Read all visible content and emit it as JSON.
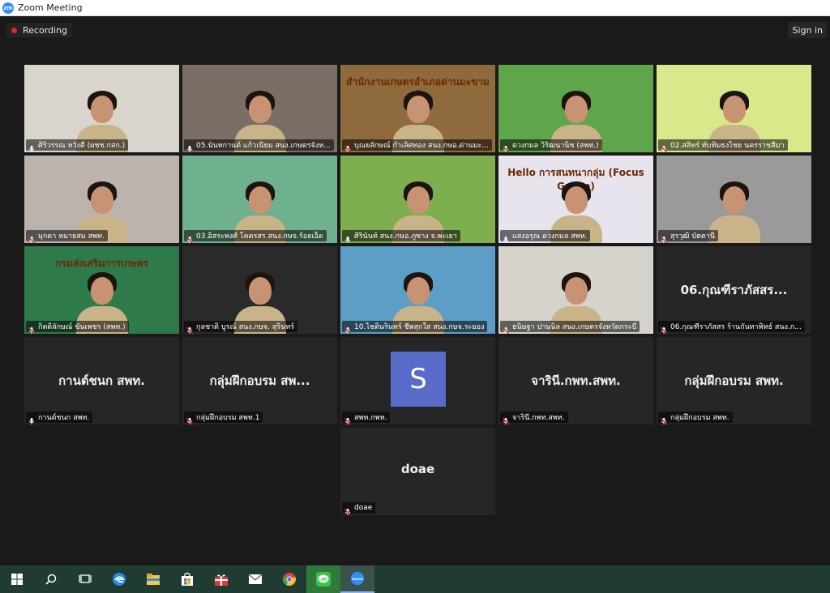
{
  "window": {
    "title": "Zoom Meeting"
  },
  "topbar": {
    "recording_label": "Recording",
    "signin_label": "Sign in"
  },
  "tiles": [
    {
      "name": "ศิริวรรณ หวังดี (ผชช.กสก.)",
      "type": "video",
      "muted": false,
      "active": false,
      "bg": "#d9d4cc"
    },
    {
      "name": "05.นันทกานต์ แก้วเนียม สนง.เกษตรจังห...",
      "type": "video",
      "muted": false,
      "active": true,
      "bg": "#7a6e66"
    },
    {
      "name": "บุณยลักษณ์ กำเลิศทอง สนง.กษอ.ด่านมะ...",
      "type": "video",
      "muted": true,
      "active": false,
      "bg": "#8f6a3c",
      "banner": "สำนักงานเกษตรอำเภอด่านมะขามเตี้ย"
    },
    {
      "name": "ดวงกมล วิริฒนานิช (สพท.)",
      "type": "video",
      "muted": true,
      "active": false,
      "bg": "#5fa64a"
    },
    {
      "name": "02.สสิทร์ ทับทิมธงไชย นครราชสีมา",
      "type": "video",
      "muted": true,
      "active": false,
      "bg": "#d8e88a"
    },
    {
      "name": "มุกดา หมายสม สพท.",
      "type": "video",
      "muted": true,
      "active": false,
      "bg": "#bdb3ae"
    },
    {
      "name": "03.อิสระพงศ์ โคตรสร สนง.กษจ.ร้อยเอ็ด",
      "type": "video",
      "muted": true,
      "active": false,
      "bg": "#6fb08f"
    },
    {
      "name": "ศิรินันท์ สนง.กษอ.ภูซาง จ.พะเยา",
      "type": "video",
      "muted": false,
      "active": false,
      "bg": "#7fae4e"
    },
    {
      "name": "แสงอรุณ ดวงกมล สพท.",
      "type": "video",
      "muted": false,
      "active": false,
      "bg": "#e8e4ee",
      "banner": "Hello การสนทนากลุ่ม (Focus Group)"
    },
    {
      "name": "สุรวุฒิ บัตตานี",
      "type": "video",
      "muted": true,
      "active": false,
      "bg": "#9a9a9a"
    },
    {
      "name": "กิตติลักษณ์ ขันเพชร (สพท.)",
      "type": "video",
      "muted": true,
      "active": false,
      "bg": "#2f7a4a",
      "banner": "กรมส่งเสริมการเกษตร"
    },
    {
      "name": "กุลชาติ บูรณ์ สนง.กษจ. สุรินทร์",
      "type": "video",
      "muted": true,
      "active": false,
      "bg": "#2a2a2a"
    },
    {
      "name": "10.ไชตินรินทร์ ชีพสุกใส สนง.กษจ.ระยอง",
      "type": "video",
      "muted": true,
      "active": false,
      "bg": "#5d9ec6"
    },
    {
      "name": "ธนิษฐา ปานนิล สนง.เกษตรจังหวัดกระบี่",
      "type": "video",
      "muted": true,
      "active": false,
      "bg": "#d6d2cc"
    },
    {
      "name": "06.กุณฑีราภัสสร ร้านกันทาพิทธ์ สนง.ก...",
      "type": "name",
      "muted": true,
      "active": false,
      "display": "06.กุณฑีราภัสสร..."
    },
    {
      "name": "กานต์ชนก สพท.",
      "type": "name",
      "muted": false,
      "active": false,
      "display": "กานต์ชนก สพท."
    },
    {
      "name": "กลุ่มฝึกอบรม สพท.1",
      "type": "name",
      "muted": true,
      "active": false,
      "display": "กลุ่มฝึกอบรม สพ..."
    },
    {
      "name": "สพท.กพท.",
      "type": "avatar",
      "muted": true,
      "active": false,
      "display": "S"
    },
    {
      "name": "จารินี.กพท.สพท.",
      "type": "name",
      "muted": true,
      "active": false,
      "display": "จารินี.กพท.สพท."
    },
    {
      "name": "กลุ่มฝึกอบรม สพท.",
      "type": "name",
      "muted": true,
      "active": false,
      "display": "กลุ่มฝึกอบรม สพท."
    },
    {
      "name": "doae",
      "type": "name",
      "muted": true,
      "active": false,
      "display": "doae"
    }
  ],
  "taskbar": {
    "items": [
      {
        "icon": "windows-start-icon",
        "active": false
      },
      {
        "icon": "search-icon",
        "active": false
      },
      {
        "icon": "task-view-icon",
        "active": false
      },
      {
        "icon": "edge-browser-icon",
        "active": false
      },
      {
        "icon": "file-explorer-icon",
        "active": false
      },
      {
        "icon": "store-icon",
        "active": false
      },
      {
        "icon": "gift-icon",
        "active": false
      },
      {
        "icon": "mail-icon",
        "active": false
      },
      {
        "icon": "chrome-icon",
        "active": false
      },
      {
        "icon": "line-app-icon",
        "active": false
      },
      {
        "icon": "zoom-app-icon",
        "active": true
      }
    ]
  }
}
